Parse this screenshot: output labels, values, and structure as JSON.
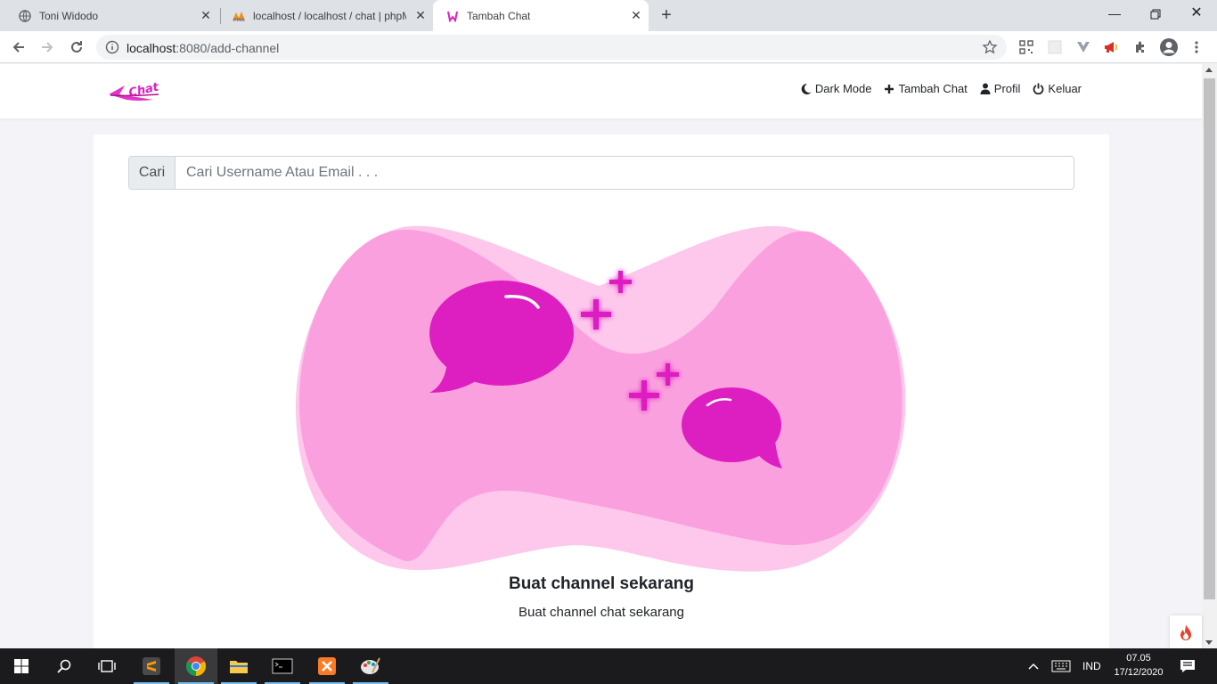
{
  "browser": {
    "tabs": [
      {
        "title": "Toni Widodo",
        "icon": "globe-icon"
      },
      {
        "title": "localhost / localhost / chat | phpMyAdmin",
        "icon": "phpmyadmin-icon"
      },
      {
        "title": "Tambah Chat",
        "icon": "chat-logo-icon"
      }
    ],
    "url_host": "localhost",
    "url_path": ":8080/add-channel"
  },
  "header": {
    "logo_text": "Chat",
    "nav": [
      {
        "label": "Dark Mode",
        "icon": "moon-icon"
      },
      {
        "label": "Tambah Chat",
        "icon": "plus-icon"
      },
      {
        "label": "Profil",
        "icon": "user-icon"
      },
      {
        "label": "Keluar",
        "icon": "power-icon"
      }
    ]
  },
  "search": {
    "addon_label": "Cari",
    "placeholder": "Cari Username Atau Email . . .",
    "value": ""
  },
  "content": {
    "heading": "Buat channel sekarang",
    "subtext": "Buat channel chat sekarang"
  },
  "colors": {
    "accent": "#dd1fc1",
    "blob_light": "#fdc8ec",
    "blob_mid": "#fba0de"
  },
  "taskbar": {
    "language": "IND",
    "time": "07.05",
    "date": "17/12/2020"
  }
}
